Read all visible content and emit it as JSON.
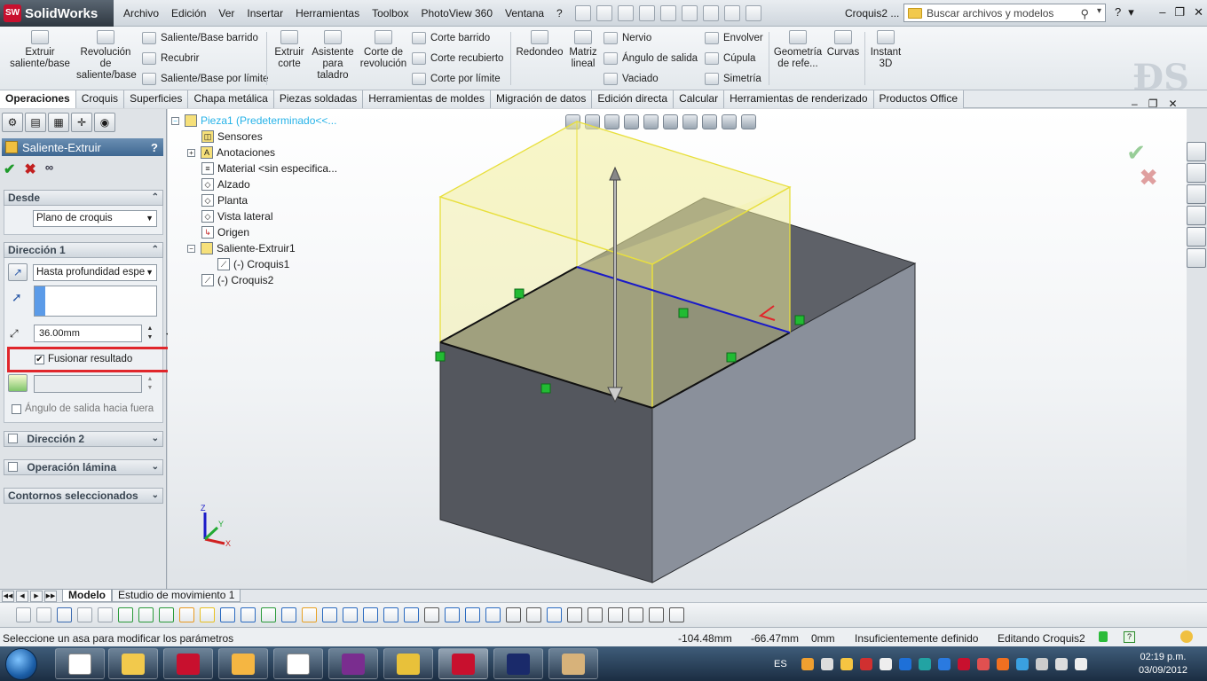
{
  "app": {
    "name": "SolidWorks",
    "doc_title": "Croquis2 ...",
    "search_placeholder": "Buscar archivos y modelos"
  },
  "menu": [
    "Archivo",
    "Edición",
    "Ver",
    "Insertar",
    "Herramientas",
    "Toolbox",
    "PhotoView 360",
    "Ventana",
    "?"
  ],
  "ribbon": {
    "extrude_boss": "Extruir saliente/base",
    "revolve_boss": "Revolución de saliente/base",
    "swept_boss": "Saliente/Base barrido",
    "wrap_top": "Recubrir",
    "boundary_boss": "Saliente/Base por límite",
    "extrude_cut": "Extruir corte",
    "hole_wizard": "Asistente para taladro",
    "revolve_cut": "Corte de revolución",
    "swept_cut": "Corte barrido",
    "loft_cut": "Corte recubierto",
    "boundary_cut": "Corte por límite",
    "fillet": "Redondeo",
    "linear_pattern": "Matriz lineal",
    "rib": "Nervio",
    "draft": "Ángulo de salida",
    "shell": "Vaciado",
    "wrap": "Envolver",
    "dome": "Cúpula",
    "mirror": "Simetría",
    "ref_geometry": "Geometría de refe...",
    "curves": "Curvas",
    "instant3d": "Instant 3D"
  },
  "tabs": [
    "Operaciones",
    "Croquis",
    "Superficies",
    "Chapa metálica",
    "Piezas soldadas",
    "Herramientas de moldes",
    "Migración de datos",
    "Edición directa",
    "Calcular",
    "Herramientas de renderizado",
    "Productos Office"
  ],
  "property_manager": {
    "title": "Saliente-Extruir",
    "help": "?",
    "from_group": "Desde",
    "from_value": "Plano de croquis",
    "direction1_group": "Dirección 1",
    "end_condition": "Hasta profundidad espe",
    "depth_value": "36.00mm",
    "merge_result_label": "Fusionar resultado",
    "merge_result_checked": true,
    "draft_outward_label": "Ángulo de salida hacia fuera",
    "direction2_group": "Dirección 2",
    "thin_feature_group": "Operación lámina",
    "selected_contours_group": "Contornos seleccionados"
  },
  "feature_tree": {
    "root": "Pieza1  (Predeterminado<<...",
    "items": [
      "Sensores",
      "Anotaciones",
      "Material <sin especifica...",
      "Alzado",
      "Planta",
      "Vista lateral",
      "Origen",
      "Saliente-Extruir1",
      "(-) Croquis1",
      "(-) Croquis2"
    ]
  },
  "bottom_tabs": [
    "Modelo",
    "Estudio de movimiento 1"
  ],
  "status": {
    "message": "Seleccione un asa para modificar los parámetros",
    "x": "-104.48mm",
    "y": "-66.47mm",
    "z": "0mm",
    "definition": "Insuficientemente definido",
    "editing": "Editando Croquis2"
  },
  "taskbar": {
    "language": "ES",
    "time": "02:19 p.m.",
    "date": "03/09/2012"
  },
  "colors": {
    "accent": "#3e6791",
    "preview_fill": "#f2ee9a",
    "preview_edge": "#e8df3c",
    "sketch_line": "#1a1ac8",
    "highlight": "#e0262b",
    "block_top": "#5d6068",
    "block_front": "#55585f",
    "block_side": "#8c929d"
  }
}
